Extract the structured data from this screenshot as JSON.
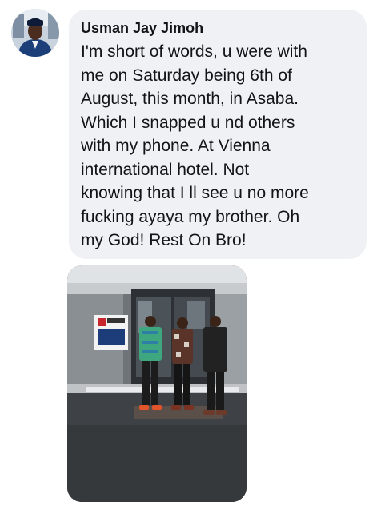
{
  "comment": {
    "author": "Usman Jay Jimoh",
    "lines": [
      "I'm short of words, u were with",
      "me on Saturday being 6th of",
      "August, this month, in Asaba.",
      "Which I snapped u nd others",
      "with my phone. At Vienna",
      "international hotel. Not",
      "knowing that I ll see u no more",
      "fucking ayaya my brother. Oh",
      "my God! Rest On Bro!"
    ]
  },
  "colors": {
    "bubble": "#eff1f4",
    "text": "#111418"
  }
}
